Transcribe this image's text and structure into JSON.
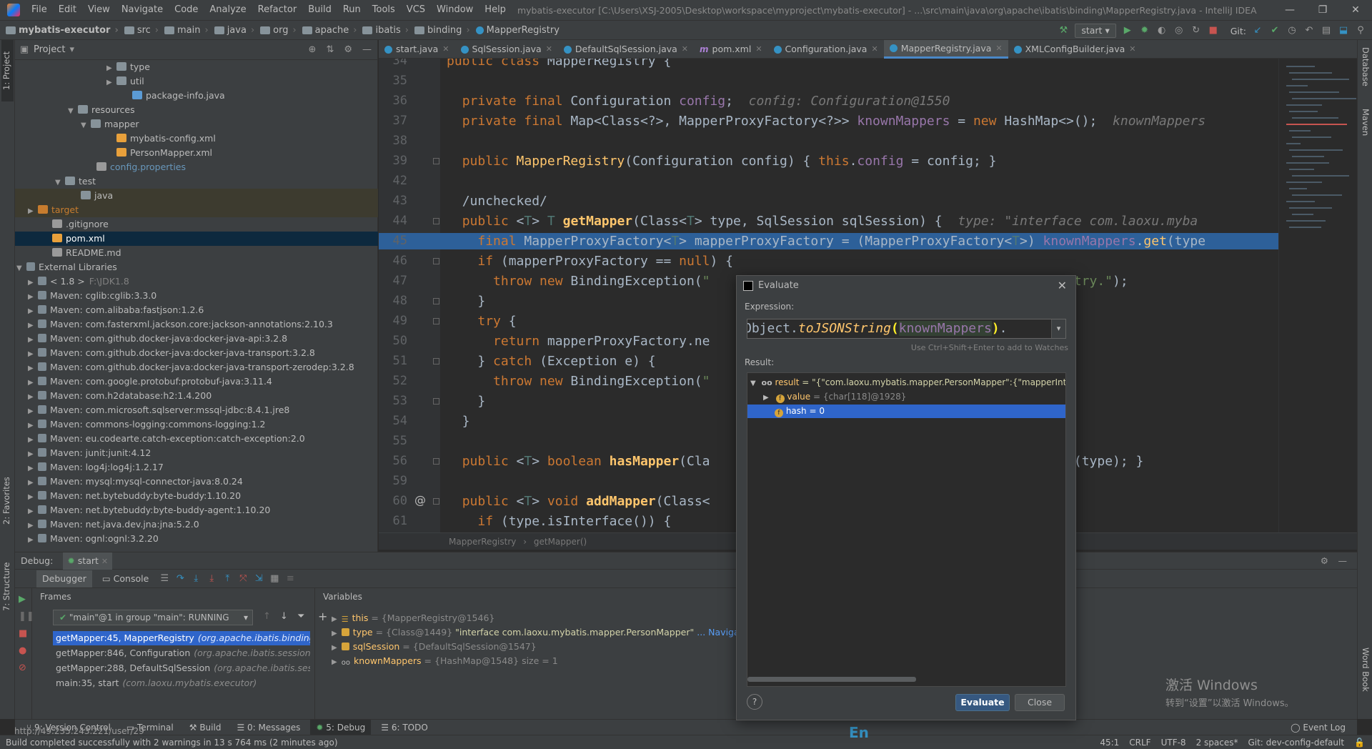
{
  "menubar": {
    "items": [
      "File",
      "Edit",
      "View",
      "Navigate",
      "Code",
      "Analyze",
      "Refactor",
      "Build",
      "Run",
      "Tools",
      "VCS",
      "Window",
      "Help"
    ],
    "title": "mybatis-executor [C:\\Users\\XSJ-2005\\Desktop\\workspace\\myproject\\mybatis-executor] - ...\\src\\main\\java\\org\\apache\\ibatis\\binding\\MapperRegistry.java - IntelliJ IDEA",
    "window_controls": [
      "—",
      "❐",
      "✕"
    ]
  },
  "navbar": {
    "crumbs": [
      "mybatis-executor",
      "src",
      "main",
      "java",
      "org",
      "apache",
      "ibatis",
      "binding",
      "MapperRegistry"
    ],
    "run_config": "start",
    "git_label": "Git:"
  },
  "project": {
    "title": "Project",
    "tree": [
      {
        "label": "type",
        "arrow": "▶",
        "icon": "folder"
      },
      {
        "label": "util",
        "arrow": "▶",
        "icon": "folder"
      },
      {
        "label": "package-info.java",
        "arrow": "",
        "icon": "file-java"
      },
      {
        "label": "resources",
        "arrow": "▼",
        "icon": "folder"
      },
      {
        "label": "mapper",
        "arrow": "▼",
        "icon": "folder"
      },
      {
        "label": "mybatis-config.xml",
        "arrow": "",
        "icon": "file-xml"
      },
      {
        "label": "PersonMapper.xml",
        "arrow": "",
        "icon": "file-xml"
      },
      {
        "label": "config.properties",
        "arrow": "",
        "icon": "file-prop"
      },
      {
        "label": "test",
        "arrow": "▼",
        "icon": "folder"
      },
      {
        "label": "java",
        "arrow": "",
        "icon": "folder"
      },
      {
        "label": "target",
        "arrow": "▶",
        "icon": "folder-orange"
      },
      {
        "label": ".gitignore",
        "arrow": "",
        "icon": "file-prop"
      },
      {
        "label": "pom.xml",
        "arrow": "",
        "icon": "file-xml"
      },
      {
        "label": "README.md",
        "arrow": "",
        "icon": "file-prop"
      },
      {
        "label": "External Libraries",
        "arrow": "▼",
        "icon": "lib"
      },
      {
        "label": "< 1.8 >",
        "extra": "F:\\JDK1.8",
        "arrow": "▶",
        "icon": "lib"
      },
      {
        "label": "Maven: cglib:cglib:3.3.0",
        "arrow": "▶",
        "icon": "lib"
      },
      {
        "label": "Maven: com.alibaba:fastjson:1.2.6",
        "arrow": "▶",
        "icon": "lib"
      },
      {
        "label": "Maven: com.fasterxml.jackson.core:jackson-annotations:2.10.3",
        "arrow": "▶",
        "icon": "lib"
      },
      {
        "label": "Maven: com.github.docker-java:docker-java-api:3.2.8",
        "arrow": "▶",
        "icon": "lib"
      },
      {
        "label": "Maven: com.github.docker-java:docker-java-transport:3.2.8",
        "arrow": "▶",
        "icon": "lib"
      },
      {
        "label": "Maven: com.github.docker-java:docker-java-transport-zerodep:3.2.8",
        "arrow": "▶",
        "icon": "lib"
      },
      {
        "label": "Maven: com.google.protobuf:protobuf-java:3.11.4",
        "arrow": "▶",
        "icon": "lib"
      },
      {
        "label": "Maven: com.h2database:h2:1.4.200",
        "arrow": "▶",
        "icon": "lib"
      },
      {
        "label": "Maven: com.microsoft.sqlserver:mssql-jdbc:8.4.1.jre8",
        "arrow": "▶",
        "icon": "lib"
      },
      {
        "label": "Maven: commons-logging:commons-logging:1.2",
        "arrow": "▶",
        "icon": "lib"
      },
      {
        "label": "Maven: eu.codearte.catch-exception:catch-exception:2.0",
        "arrow": "▶",
        "icon": "lib"
      },
      {
        "label": "Maven: junit:junit:4.12",
        "arrow": "▶",
        "icon": "lib"
      },
      {
        "label": "Maven: log4j:log4j:1.2.17",
        "arrow": "▶",
        "icon": "lib"
      },
      {
        "label": "Maven: mysql:mysql-connector-java:8.0.24",
        "arrow": "▶",
        "icon": "lib"
      },
      {
        "label": "Maven: net.bytebuddy:byte-buddy:1.10.20",
        "arrow": "▶",
        "icon": "lib"
      },
      {
        "label": "Maven: net.bytebuddy:byte-buddy-agent:1.10.20",
        "arrow": "▶",
        "icon": "lib"
      },
      {
        "label": "Maven: net.java.dev.jna:jna:5.2.0",
        "arrow": "▶",
        "icon": "lib"
      },
      {
        "label": "Maven: ognl:ognl:3.2.20",
        "arrow": "▶",
        "icon": "lib"
      }
    ]
  },
  "editor_tabs": [
    {
      "label": "start.java",
      "icon": "c"
    },
    {
      "label": "SqlSession.java",
      "icon": "c"
    },
    {
      "label": "DefaultSqlSession.java",
      "icon": "c"
    },
    {
      "label": "pom.xml",
      "icon": "m"
    },
    {
      "label": "Configuration.java",
      "icon": "c"
    },
    {
      "label": "MapperRegistry.java",
      "icon": "c",
      "active": true
    },
    {
      "label": "XMLConfigBuilder.java",
      "icon": "c"
    }
  ],
  "editor": {
    "line_numbers": [
      "34",
      "35",
      "36",
      "37",
      "38",
      "39",
      "42",
      "43",
      "44",
      "45",
      "46",
      "47",
      "48",
      "49",
      "50",
      "51",
      "52",
      "53",
      "54",
      "55",
      "56",
      "59",
      "60",
      "61"
    ],
    "breadcrumb": [
      "MapperRegistry",
      "getMapper()"
    ]
  },
  "debug": {
    "label": "Debug:",
    "session_tab": "start",
    "toolbar_tabs": [
      "Debugger",
      "Console"
    ],
    "frames_title": "Frames",
    "variables_title": "Variables",
    "thread": "\"main\"@1 in group \"main\": RUNNING",
    "frames": [
      {
        "method": "getMapper:45, MapperRegistry",
        "pkg": "(org.apache.ibatis.binding)"
      },
      {
        "method": "getMapper:846, Configuration",
        "pkg": "(org.apache.ibatis.session)"
      },
      {
        "method": "getMapper:288, DefaultSqlSession",
        "pkg": "(org.apache.ibatis.session)"
      },
      {
        "method": "main:35, start",
        "pkg": "(com.laoxu.mybatis.executor)"
      }
    ],
    "variables": [
      {
        "name": "this",
        "value": " = {MapperRegistry@1546}",
        "extra": "",
        "link": ""
      },
      {
        "name": "type",
        "value": " = {Class@1449} ",
        "extra": "\"interface com.laoxu.mybatis.mapper.PersonMapper\"",
        "link": "... Navigate"
      },
      {
        "name": "sqlSession",
        "value": " = {DefaultSqlSession@1547}",
        "extra": "",
        "link": ""
      },
      {
        "name": "knownMappers",
        "value": " = {HashMap@1548}  size = 1",
        "extra": "",
        "link": ""
      }
    ]
  },
  "bottom_tabs": [
    "9: Version Control",
    "Terminal",
    "Build",
    "0: Messages",
    "5: Debug",
    "6: TODO"
  ],
  "event_log": "Event Log",
  "status": {
    "left": "Build completed successfully with 2 warnings in 13 s 764 ms (2 minutes ago)",
    "url_overlay": "http://49.235.243.221/user/29",
    "position": "45:1",
    "line_sep": "CRLF",
    "encoding": "UTF-8",
    "indent": "2 spaces*",
    "git_branch": "Git: dev-config-default",
    "ime": "En"
  },
  "evaluate": {
    "title": "Evaluate",
    "expression_label": "Expression:",
    "expression_prefix": "Object.",
    "expression_method": "toJSONString",
    "expression_arg": "knownMappers",
    "hint": "Use Ctrl+Shift+Enter to add to Watches",
    "result_label": "Result:",
    "result_name": "result",
    "result_value": " = \"{\"com.laoxu.mybatis.mapper.PersonMapper\":{\"mapperInterfa",
    "value_name": "value",
    "value_val": " = {char[118]@1928}",
    "hash_text": "hash = 0",
    "evaluate_button": "Evaluate",
    "close_button": "Close",
    "help": "?"
  },
  "watermark": {
    "line1": "激活 Windows",
    "line2": "转到“设置”以激活 Windows。"
  },
  "side_tabs": {
    "left": [
      "1: Project",
      "2: Favorites",
      "7: Structure"
    ],
    "right": [
      "Database",
      "Maven",
      "Word Book"
    ]
  },
  "colors": {
    "background": "#2b2b2b",
    "panel": "#3c3f41",
    "selection": "#2f65ca",
    "exec_line": "#2d6099",
    "accent": "#4a88c7"
  }
}
